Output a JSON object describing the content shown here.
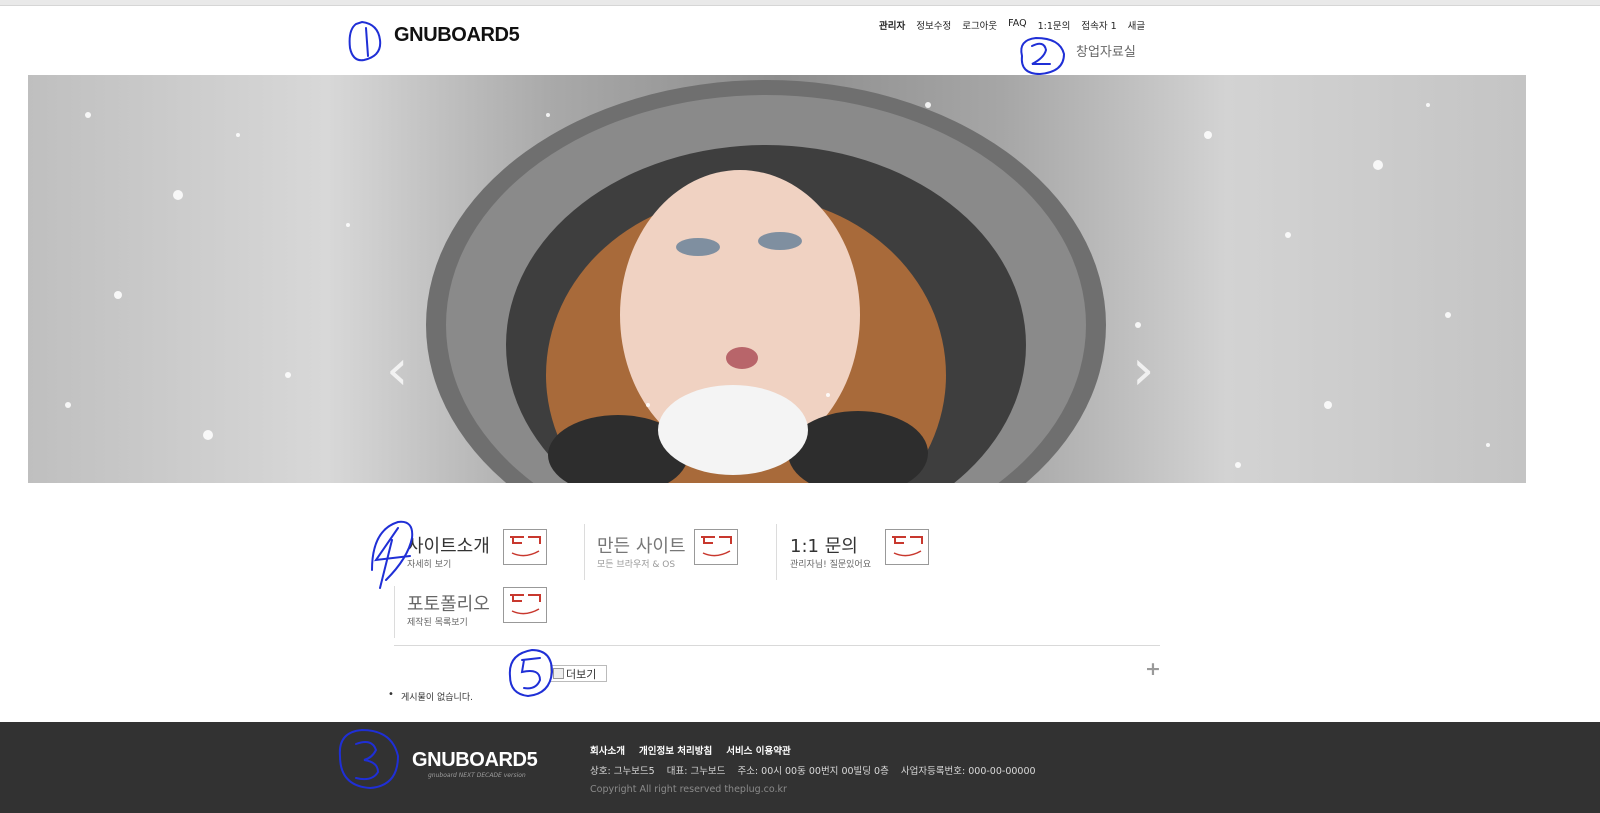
{
  "header": {
    "logo": "GNUBOARD5",
    "top_nav": [
      "관리자",
      "정보수정",
      "로그아웃",
      "FAQ",
      "1:1문의",
      "접속자 1",
      "새글"
    ],
    "sub_nav": "창업자료실"
  },
  "hero": {
    "prev_icon": "chevron-left-icon",
    "next_icon": "chevron-right-icon",
    "prev_glyph": "‹",
    "next_glyph": "›"
  },
  "services": [
    {
      "title": "사이트소개",
      "desc": "자세히 보기"
    },
    {
      "title": "만든 사이트",
      "desc": "모든 브라우저 & OS"
    },
    {
      "title": "1:1 문의",
      "desc": "관리자님! 질문있어요"
    },
    {
      "title": "포토폴리오",
      "desc": "제작된 목록보기"
    }
  ],
  "latest": {
    "more_alt": "더보기",
    "plus": "+",
    "empty_text": "게시물이 없습니다."
  },
  "footer": {
    "logo": "GNUBOARD5",
    "logo_sub": "gnuboard NEXT DECADE version",
    "links": [
      "회사소개",
      "개인정보 처리방침",
      "서비스 이용약관"
    ],
    "info": [
      "상호: 그누보드5",
      "대표: 그누보드",
      "주소: 00시 00동 00번지 00빌딩 0층",
      "사업자등록번호: 000-00-00000"
    ],
    "copyright": "Copyright All right reserved theplug.co.kr"
  },
  "colors": {
    "footer_bg": "#323232",
    "annotation_pen": "#1f2fd6",
    "badge_red": "#c8382e"
  }
}
